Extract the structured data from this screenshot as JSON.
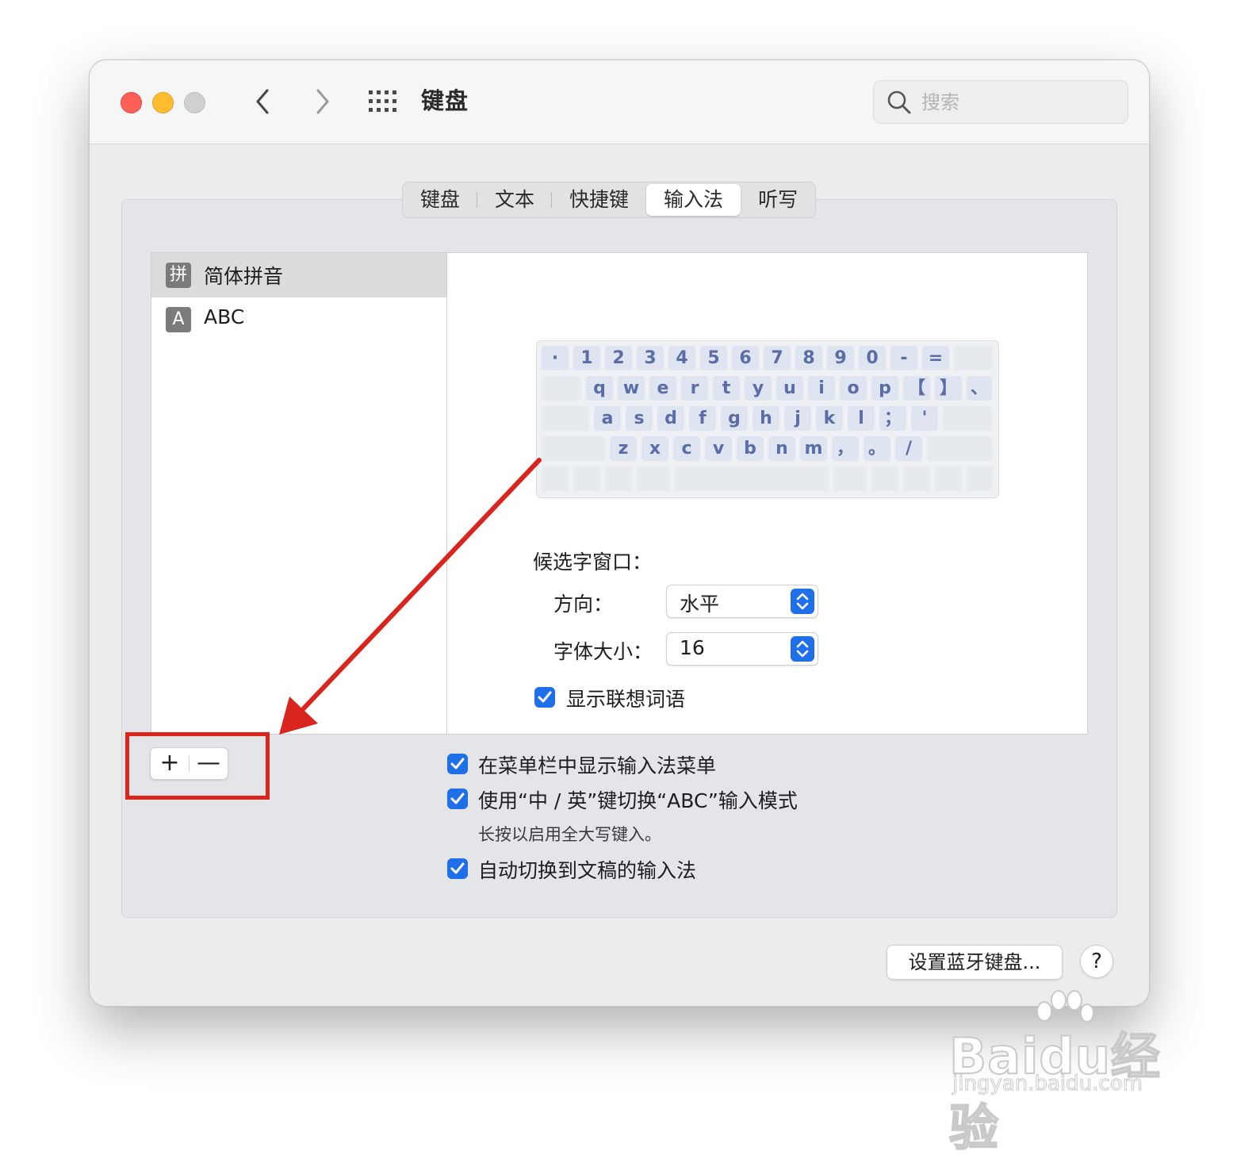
{
  "window": {
    "title": "键盘",
    "search_placeholder": "搜索"
  },
  "tabs": [
    {
      "label": "键盘",
      "active": false
    },
    {
      "label": "文本",
      "active": false
    },
    {
      "label": "快捷键",
      "active": false
    },
    {
      "label": "输入法",
      "active": true
    },
    {
      "label": "听写",
      "active": false
    }
  ],
  "input_sources": [
    {
      "icon_text": "拼",
      "label": "简体拼音",
      "selected": true
    },
    {
      "icon_text": "A",
      "label": "ABC",
      "selected": false
    }
  ],
  "keyboard_layout": {
    "row1": [
      "·",
      "1",
      "2",
      "3",
      "4",
      "5",
      "6",
      "7",
      "8",
      "9",
      "0",
      "-",
      "="
    ],
    "row2": [
      "q",
      "w",
      "e",
      "r",
      "t",
      "y",
      "u",
      "i",
      "o",
      "p",
      "【",
      "】",
      "、"
    ],
    "row3": [
      "a",
      "s",
      "d",
      "f",
      "g",
      "h",
      "j",
      "k",
      "l",
      "；",
      "'"
    ],
    "row4": [
      "z",
      "x",
      "c",
      "v",
      "b",
      "n",
      "m",
      "，",
      "。",
      "/"
    ]
  },
  "candidate_window": {
    "title": "候选字窗口：",
    "direction_label": "方向：",
    "direction_value": "水平",
    "font_size_label": "字体大小：",
    "font_size_value": "16",
    "show_predictive_label": "显示联想词语",
    "show_predictive_checked": true
  },
  "list_buttons": {
    "add": "+",
    "remove": "—"
  },
  "options": {
    "menu_bar": {
      "label": "在菜单栏中显示输入法菜单",
      "checked": true
    },
    "zh_en_key": {
      "label": "使用“中 / 英”键切换“ABC”输入模式",
      "checked": true,
      "hint": "长按以启用全大写键入。"
    },
    "auto_switch": {
      "label": "自动切换到文稿的输入法",
      "checked": true
    }
  },
  "footer": {
    "bluetooth_button": "设置蓝牙键盘...",
    "help_button": "?"
  },
  "watermark": {
    "brand": "Baidu经验",
    "url": "jingyan.baidu.com"
  },
  "colors": {
    "accent_blue": "#1e6fe8",
    "annotation_red": "#d9251d",
    "traffic_red": "#fe5f57",
    "traffic_yellow": "#febc2e",
    "key_text": "#5b6da8"
  }
}
